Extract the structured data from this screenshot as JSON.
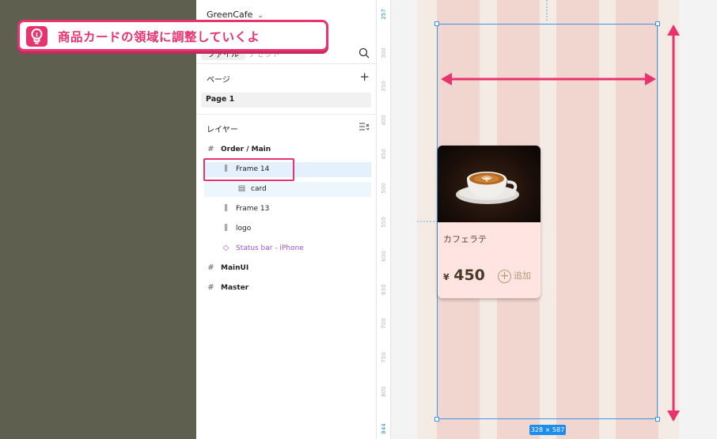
{
  "file": {
    "name": "GreenCafe"
  },
  "tabs": [
    {
      "label": "ファイル"
    },
    {
      "label": "アセット"
    }
  ],
  "pages": {
    "title": "ページ",
    "items": [
      {
        "label": "Page 1"
      }
    ]
  },
  "layers": {
    "title": "レイヤー",
    "items": [
      {
        "label": "Order / Main"
      },
      {
        "label": "Frame 14"
      },
      {
        "label": "card"
      },
      {
        "label": "Frame 13"
      },
      {
        "label": "logo"
      },
      {
        "label": "Status bar - iPhone"
      },
      {
        "label": "MainUI"
      },
      {
        "label": "Master"
      }
    ]
  },
  "ruler": {
    "ticks": [
      "257",
      "300",
      "350",
      "400",
      "450",
      "500",
      "550",
      "600",
      "650",
      "700",
      "750",
      "800",
      "844"
    ]
  },
  "selection": {
    "size": "328 × 587"
  },
  "card": {
    "name": "カフェラテ",
    "currency": "¥",
    "price": "450",
    "add_label": "追加"
  },
  "tooltip": {
    "text": "商品カードの領域に調整していくよ"
  },
  "colors": {
    "accent": "#e8336f",
    "selection": "#3a96ec",
    "card_bg": "#ffe4e1",
    "column": "#f1d6cf"
  }
}
